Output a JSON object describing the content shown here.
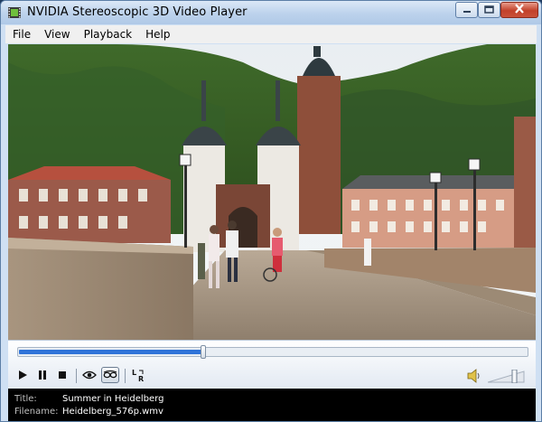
{
  "window": {
    "title": "NVIDIA Stereoscopic 3D Video Player",
    "icons": {
      "app": "film-strip-icon",
      "minimize": "minimize-icon",
      "maximize": "maximize-icon",
      "close": "close-icon"
    }
  },
  "menu": [
    "File",
    "View",
    "Playback",
    "Help"
  ],
  "video": {
    "scene": "bridge-and-gate-towers"
  },
  "playback": {
    "progress": 0.36,
    "controls": [
      "play-icon",
      "pause-icon",
      "stop-icon",
      "eye-icon",
      "stereo-glasses-icon",
      "swap-eyes-icon"
    ],
    "volume": 0.75,
    "volume_icon": "speaker-icon"
  },
  "info": {
    "title_label": "Title:",
    "title_value": "Summer in Heidelberg",
    "filename_label": "Filename:",
    "filename_value": "Heidelberg_576p.wmv"
  },
  "colors": {
    "accent": "#2f73d8",
    "titlebar": "#bcd2ec",
    "close_button": "#c2412a",
    "info_background": "#000000"
  }
}
